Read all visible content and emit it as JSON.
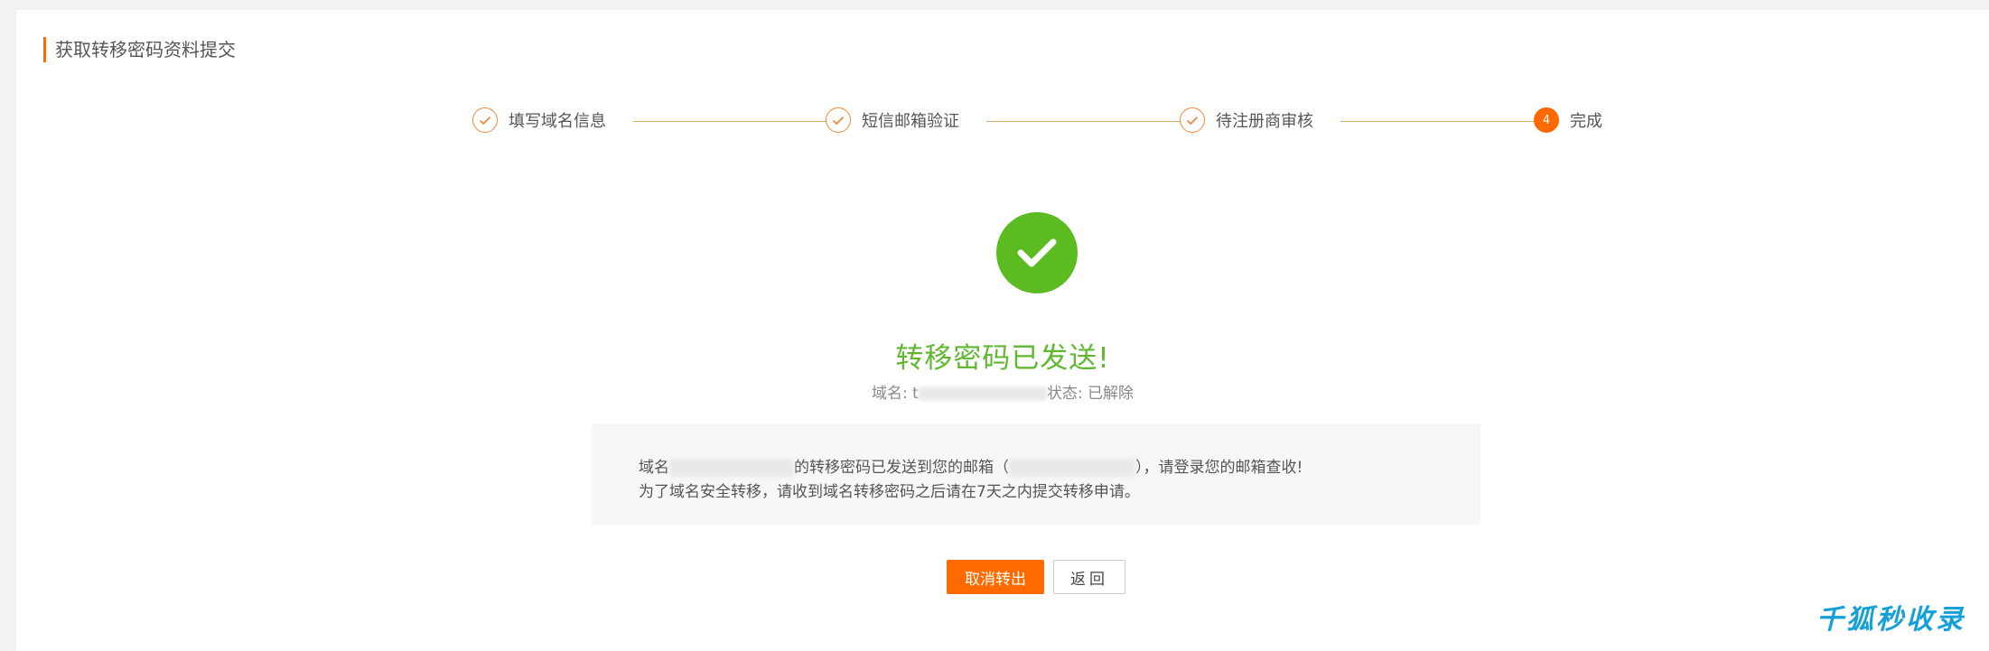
{
  "header": {
    "title": "获取转移密码资料提交"
  },
  "steps": [
    {
      "label": "填写域名信息",
      "status": "done"
    },
    {
      "label": "短信邮箱验证",
      "status": "done"
    },
    {
      "label": "待注册商审核",
      "status": "done"
    },
    {
      "label": "完成",
      "number": "4",
      "status": "active"
    }
  ],
  "result": {
    "title": "转移密码已发送!",
    "domain_prefix": "域名: t",
    "status_suffix": "状态: 已解除"
  },
  "info": {
    "line1_prefix": "域名",
    "line1_middle": "的转移密码已发送到您的邮箱（",
    "line1_suffix": "），请登录您的邮箱查收!",
    "line2": "为了域名安全转移，请收到域名转移密码之后请在7天之内提交转移申请。"
  },
  "buttons": {
    "cancel": "取消转出",
    "back": "返回"
  },
  "watermark": "千狐秒收录",
  "colors": {
    "accent": "#ff6a00",
    "success": "#5bbb20",
    "watermark": "#15a0d8"
  }
}
